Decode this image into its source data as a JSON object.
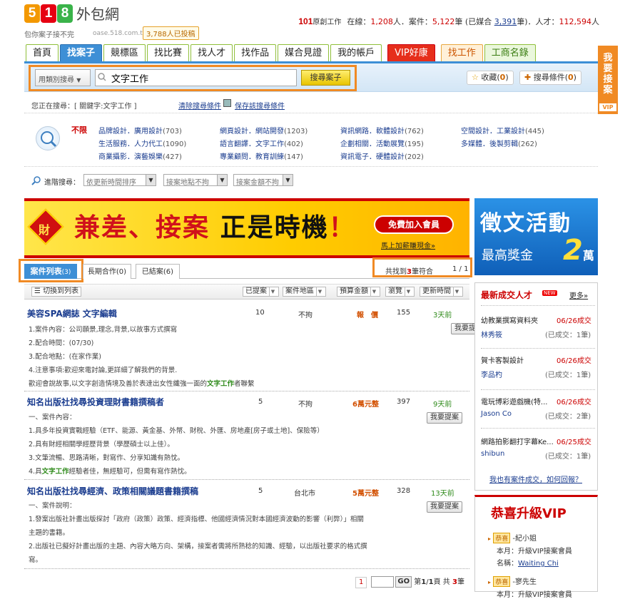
{
  "header": {
    "logo_digits": [
      "5",
      "1",
      "8"
    ],
    "logo_colors": [
      "#f39800",
      "#e60012",
      "#3ab34a"
    ],
    "logo_text": "外包網",
    "slogan": "包你案子接不完",
    "domain": "oase.518.com.tw",
    "bid_badge": "3,788人已投稿",
    "stats_prefix": "101",
    "stats_brand": "原創工作",
    "online_label": "在線：",
    "online_count": "1,208",
    "online_unit": "人．案件：",
    "cases_count": "5,122",
    "cases_unit": "筆 (已媒合 ",
    "matched_count": "3,391",
    "matched_unit": "筆)．人才：",
    "talent_count": "112,594",
    "talent_unit": "人"
  },
  "nav": {
    "tabs": [
      "首頁",
      "找案子",
      "競標區",
      "找比賽",
      "找人才",
      "找作品",
      "媒合見證",
      "我的帳戶",
      "VIP好康",
      "找工作",
      "工商名錄"
    ]
  },
  "search": {
    "category_select": "用類別搜尋",
    "keyword": "文字工作",
    "search_button": "搜尋案子",
    "fav_label": "收藏(",
    "fav_count": "0",
    "cond_label": "搜尋條件(",
    "cond_count": "0",
    "close_paren": ")",
    "searching_text": "您正在搜尋：[ 關鍵字:文字工作 ]",
    "clear_link": "清除搜尋條件",
    "save_link": "保存該搜尋條件"
  },
  "categories": {
    "unlimited": "不限",
    "items": [
      {
        "label": "品牌設計．廣用設計",
        "count": "(703)"
      },
      {
        "label": "網頁設計．網站開發",
        "count": "(1203)"
      },
      {
        "label": "資訊網路．軟體設計",
        "count": "(762)"
      },
      {
        "label": "空間設計．工業設計",
        "count": "(445)"
      },
      {
        "label": "生活服務．人力代工",
        "count": "(1090)"
      },
      {
        "label": "語言翻譯．文字工作",
        "count": "(402)"
      },
      {
        "label": "企劃相關．活動展覽",
        "count": "(195)"
      },
      {
        "label": "多媒體．後製剪輯",
        "count": "(262)"
      },
      {
        "label": "商業攝影．演藝娛樂",
        "count": "(427)"
      },
      {
        "label": "專業顧問．教育訓練",
        "count": "(147)"
      },
      {
        "label": "資訊電子．硬體設計",
        "count": "(202)"
      }
    ]
  },
  "advanced": {
    "label": "進階搜尋：",
    "selects": [
      "依更新時間排序",
      "接案地點不拘",
      "接案金額不拘"
    ]
  },
  "banner": {
    "fu": "財",
    "text_red": "兼差、接案",
    "text_black": "正是時機",
    "text_end": "！",
    "free_button": "免費加入會員",
    "cash_link": "馬上加薪賺現金»",
    "right_title": "徵文活動",
    "right_sub": "最高獎金",
    "right_amount": "2",
    "right_unit": "萬"
  },
  "tabs": {
    "list": "案件列表",
    "list_count": "(3)",
    "longterm": "長期合作",
    "longterm_count": "(0)",
    "closed": "已結案",
    "closed_count": "(6)",
    "found_prefix": "共找到",
    "found_count": "3",
    "found_suffix": "筆符合",
    "page": "1 / 1"
  },
  "listhead": {
    "switch": "切換到列表",
    "cols": [
      "已提案",
      "案件地區",
      "預算金額",
      "瀏覽",
      "更新時間"
    ]
  },
  "cases": [
    {
      "title": "美容SPA網誌 文字編輯",
      "proposals": "10",
      "region": "不拘",
      "budget": "報　價",
      "views": "155",
      "updated": "3天前",
      "bid": "我要提案",
      "lines": [
        "1.案件內容：公司願景,理念,背景,以故事方式撰寫",
        "2.配合時間：(07/30)",
        "3.配合地點：(在家作業)",
        "4.注意事項:歡迎來電討論,更詳細了解我們的背景.",
        "歡迎會說故事,以文字創造情境及善於表達出女性纖強一面的",
        "文字工作",
        "者聯繫"
      ]
    },
    {
      "title": "知名出版社找尋投資理財書籍撰稿者",
      "proposals": "5",
      "region": "不拘",
      "budget": "6萬元整",
      "views": "397",
      "updated": "9天前",
      "bid": "我要提案",
      "lines": [
        "一、案件內容：",
        "1.具多年投資實戰經驗（ETF、能源、黃金基、外幣、財稅、外匯、房地產[房子或土地]、保險等）",
        "2.具有財經相關學經歷背景（學歷碩士以上佳）。",
        "3.文筆流暢、思路清晰，對寫作、分享知識有熱忱。",
        "4.具",
        "文字工作",
        "經驗者佳，無經驗可，但需有寫作熱忱。"
      ]
    },
    {
      "title": "知名出版社找尋經濟、政策相關議題書籍撰稿",
      "proposals": "5",
      "region": "台北市",
      "budget": "5萬元整",
      "views": "328",
      "updated": "13天前",
      "bid": "我要提案",
      "lines": [
        "一、案件說明：",
        "1.發案出版社計畫出版探討「政府（政策）政策、經濟指標、他國經濟情況對本國經濟波動的影響（利弊）」相關",
        "主題的書籍。",
        "2.出版社已擬好計畫出版的主題、內容大略方向、架構，接案者需將所熟稔的知識、經驗，以出版社要求的格式撰",
        "寫。"
      ]
    }
  ],
  "bottom_pager": {
    "page": "1",
    "go": "GO",
    "prefix": "第",
    "current": "1",
    "sep": "/",
    "total": "1",
    "page_unit": "頁 共",
    "count": "3",
    "count_unit": "筆"
  },
  "talent": {
    "title": "最新成交人才",
    "new": "NEW",
    "more": "更多»",
    "rows": [
      {
        "name": "幼教業撰寫資料夾",
        "date": "06/26成交",
        "user": "林秀筱",
        "count": "(已成交：1筆)"
      },
      {
        "name": "賀卡客製設計",
        "date": "06/26成交",
        "user": "李品杓",
        "count": "(已成交：1筆)"
      },
      {
        "name": "電玩博彩遊戲機(特...",
        "date": "06/26成交",
        "user": "Jason Co",
        "count": "(已成交：2筆)"
      },
      {
        "name": "網路拍影翻打字幕Ke...",
        "date": "06/25成交",
        "user": "shibun",
        "count": "(已成交：1筆)"
      }
    ],
    "also_link": "我也有案件成交，如何回報？"
  },
  "vip": {
    "title": "恭喜升級VIP",
    "entries": [
      {
        "tag": "恭喜",
        "name": "-紀小姐",
        "line2": "本月：升級VIP接案會員",
        "line3_label": "名稱：",
        "line3_value": "Waiting Chi"
      },
      {
        "tag": "恭喜",
        "name": "-寥先生",
        "line2": "本月：升級VIP接案會員"
      }
    ]
  },
  "ribbon": {
    "text": "我要接案",
    "vip": "VIP"
  }
}
